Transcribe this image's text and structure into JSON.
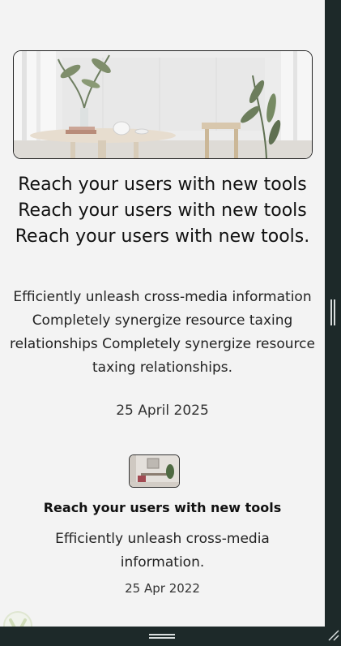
{
  "featured": {
    "image_alt": "interior-photo",
    "title": "Reach your users with new tools Reach your users with new tools Reach your users with new tools.",
    "summary": "Efficiently unleash cross-media information Completely synergize resource taxing relationships Completely synergize resource taxing relationships.",
    "date": "25 April 2025"
  },
  "card": {
    "image_alt": "room-thumbnail",
    "title": "Reach your users with new tools",
    "summary": "Efficiently unleash cross-media information.",
    "date": "25 Apr 2022"
  },
  "icons": {
    "rail_grip": "vertical-grip-icon",
    "bottom_grip": "horizontal-grip-icon",
    "resize": "resize-corner-icon",
    "watermark": "watermark-logo-icon"
  },
  "colors": {
    "page_bg": "#f3f3f3",
    "chrome": "#1d2929",
    "text": "#111111"
  }
}
